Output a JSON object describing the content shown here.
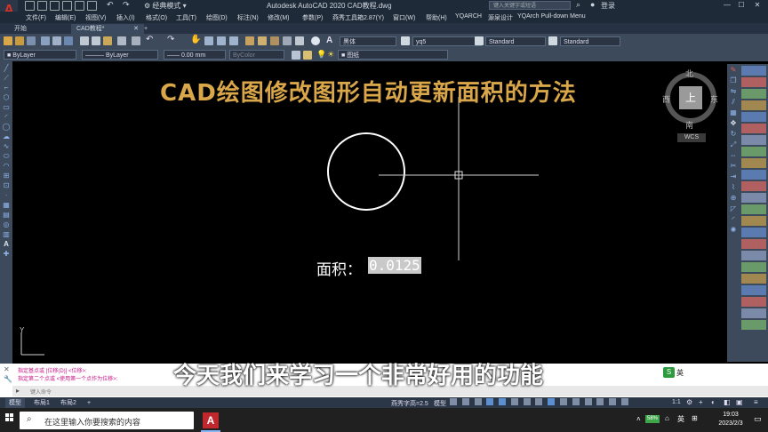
{
  "app": {
    "logo": "A",
    "workspace": "经典模式",
    "title": "Autodesk AutoCAD 2020   CAD教程.dwg",
    "search_placeholder": "键入关键字或短语",
    "login": "登录"
  },
  "menu": [
    "文件(F)",
    "编辑(E)",
    "视图(V)",
    "插入(I)",
    "格式(O)",
    "工具(T)",
    "绘图(D)",
    "标注(N)",
    "修改(M)",
    "参数(P)",
    "燕秀工具箱2.87(Y)",
    "窗口(W)",
    "帮助(H)",
    "YQARCH",
    "源泉设计",
    "YQArch Pull-down Menu"
  ],
  "tabs": {
    "start": "开始",
    "doc": "CAD教程*",
    "plus": "+"
  },
  "toolbar": {
    "text_font": "黑体",
    "text_style": "yq5",
    "dim_style": "Standard",
    "table_style": "Standard"
  },
  "props": {
    "layer": "ByLayer",
    "linetype": "ByLayer",
    "lineweight": "0.00 mm",
    "color": "ByColor",
    "layer_name": "图纸"
  },
  "canvas": {
    "title": "CAD绘图修改图形自动更新面积的方法",
    "area_label": "面积：",
    "area_value": "0.0125",
    "subtitle": "今天我们来学习一个非常好用的功能",
    "ucs_y": "Y"
  },
  "viewcube": {
    "north": "北",
    "south": "南",
    "east": "东",
    "west": "西",
    "top": "上",
    "wcs": "WCS"
  },
  "command": {
    "line1": "指定基点或 [位移(D)] <位移>:",
    "line2": "指定第二个点或 <使用第一个点作为位移>:",
    "input_placeholder": "键入命令"
  },
  "layout_tabs": [
    "模型",
    "布局1",
    "布局2",
    "+"
  ],
  "status": {
    "annotation": "燕秀字高=2.5",
    "model": "模型",
    "scale": "1:1"
  },
  "taskbar": {
    "search": "在这里输入你要搜索的内容",
    "battery": "58%",
    "ime": "英",
    "time": "19:03",
    "date": "2023/2/3",
    "ime2": "英"
  },
  "colors": {
    "title": "#d9a64a",
    "cmd_text": "#c71585",
    "circle": "#ffffff"
  }
}
